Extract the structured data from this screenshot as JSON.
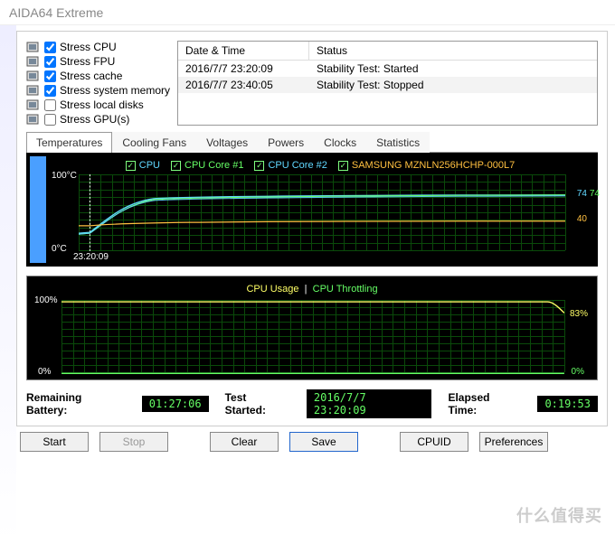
{
  "title": "AIDA64 Extreme",
  "stress_options": [
    {
      "label": "Stress CPU",
      "checked": true,
      "icon": "cpu-icon"
    },
    {
      "label": "Stress FPU",
      "checked": true,
      "icon": "fpu-icon"
    },
    {
      "label": "Stress cache",
      "checked": true,
      "icon": "cache-icon"
    },
    {
      "label": "Stress system memory",
      "checked": true,
      "icon": "memory-icon"
    },
    {
      "label": "Stress local disks",
      "checked": false,
      "icon": "disk-icon"
    },
    {
      "label": "Stress GPU(s)",
      "checked": false,
      "icon": "gpu-icon"
    }
  ],
  "events": {
    "headers": [
      "Date & Time",
      "Status"
    ],
    "rows": [
      {
        "datetime": "2016/7/7 23:20:09",
        "status": "Stability Test: Started"
      },
      {
        "datetime": "2016/7/7 23:40:05",
        "status": "Stability Test: Stopped"
      }
    ]
  },
  "tabs": [
    "Temperatures",
    "Cooling Fans",
    "Voltages",
    "Powers",
    "Clocks",
    "Statistics"
  ],
  "active_tab": 0,
  "chart_data": [
    {
      "type": "line",
      "title": "Temperatures",
      "ylabel": "°C",
      "ylim": [
        0,
        100
      ],
      "x_start_label": "23:20:09",
      "legend": [
        {
          "name": "CPU",
          "color": "#60d8ff",
          "end_value": 74
        },
        {
          "name": "CPU Core #1",
          "color": "#66ff66",
          "end_value": 74
        },
        {
          "name": "CPU Core #2",
          "color": "#60d8ff",
          "end_value": 74
        },
        {
          "name": "SAMSUNG MZNLN256HCHP-000L7",
          "color": "#ffc040",
          "end_value": 40
        }
      ],
      "right_labels": [
        {
          "text": "74",
          "color": "#60d8ff"
        },
        {
          "text": "74",
          "color": "#66ff66"
        },
        {
          "text": "40",
          "color": "#ffc040"
        }
      ],
      "axis_ticks_left": [
        "100°C",
        "0°C"
      ]
    },
    {
      "type": "line",
      "title_parts": {
        "usage": "CPU Usage",
        "sep": "|",
        "throttling": "CPU Throttling"
      },
      "ylim": [
        0,
        100
      ],
      "left_ticks": [
        "100%",
        "0%"
      ],
      "right_labels": [
        {
          "text": "83%",
          "color": "#ffff66"
        },
        {
          "text": "0%",
          "color": "#66ff66"
        }
      ],
      "series": [
        {
          "name": "CPU Usage",
          "color": "#ffff66",
          "flat_value": 100,
          "end_value": 83
        },
        {
          "name": "CPU Throttling",
          "color": "#66ff66",
          "flat_value": 0,
          "end_value": 0
        }
      ]
    }
  ],
  "status": {
    "battery_label": "Remaining Battery:",
    "battery_value": "01:27:06",
    "started_label": "Test Started:",
    "started_value": "2016/7/7 23:20:09",
    "elapsed_label": "Elapsed Time:",
    "elapsed_value": "0:19:53"
  },
  "buttons": {
    "start": "Start",
    "stop": "Stop",
    "clear": "Clear",
    "save": "Save",
    "cpuid": "CPUID",
    "preferences": "Preferences"
  },
  "watermark": "什么值得买"
}
